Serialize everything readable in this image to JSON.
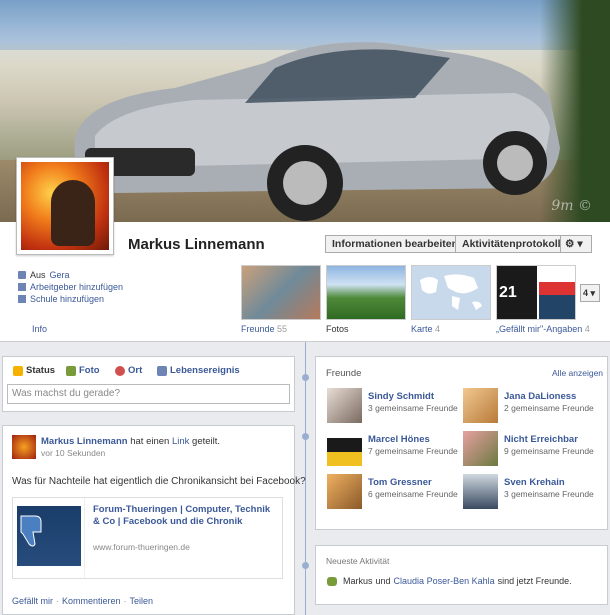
{
  "profile": {
    "name": "Markus Linnemann",
    "watermark": "9m ©"
  },
  "header_buttons": {
    "edit_info": "Informationen bearbeiten",
    "activity_log": "Aktivitätenprotokoll",
    "settings": "⚙ ▾"
  },
  "about": {
    "from_prefix": "Aus",
    "from_place": "Gera",
    "add_employer": "Arbeitgeber hinzufügen",
    "add_school": "Schule hinzufügen",
    "info_label": "Info"
  },
  "tiles": {
    "friends_label": "Freunde",
    "friends_count": "55",
    "photos_label": "Fotos",
    "map_label": "Karte",
    "map_count": "4",
    "likes_label": "„Gefällt mir\"-Angaben",
    "likes_count": "4",
    "more": "4 ▾"
  },
  "composer": {
    "status": "Status",
    "photo": "Foto",
    "place": "Ort",
    "life_event": "Lebensereignis",
    "placeholder": "Was machst du gerade?"
  },
  "post": {
    "author": "Markus Linnemann",
    "action_prefix": "hat einen",
    "action_link": "Link",
    "action_suffix": "geteilt.",
    "time": "vor 10 Sekunden",
    "text": "Was für Nachteile hat eigentlich die Chronikansicht bei Facebook?",
    "share_title": "Forum-Thueringen | Computer, Technik & Co | Facebook und die Chronik",
    "share_url": "www.forum-thueringen.de",
    "like": "Gefällt mir",
    "comment": "Kommentieren",
    "share": "Teilen",
    "sep": "·"
  },
  "friends_box": {
    "title": "Freunde",
    "show_all": "Alle anzeigen",
    "items": [
      {
        "name": "Sindy Schmidt",
        "mutual": "3 gemeinsame Freunde"
      },
      {
        "name": "Jana DaLioness",
        "mutual": "2 gemeinsame Freunde"
      },
      {
        "name": "Marcel Hönes",
        "mutual": "7 gemeinsame Freunde"
      },
      {
        "name": "Nicht Erreichbar",
        "mutual": "9 gemeinsame Freunde"
      },
      {
        "name": "Tom Gressner",
        "mutual": "6 gemeinsame Freunde"
      },
      {
        "name": "Sven Krehain",
        "mutual": "3 gemeinsame Freunde"
      }
    ]
  },
  "activity": {
    "title": "Neueste Aktivität",
    "actor": "Markus",
    "and": "und",
    "other": "Claudia Poser-Ben Kahla",
    "suffix": "sind jetzt Freunde."
  }
}
